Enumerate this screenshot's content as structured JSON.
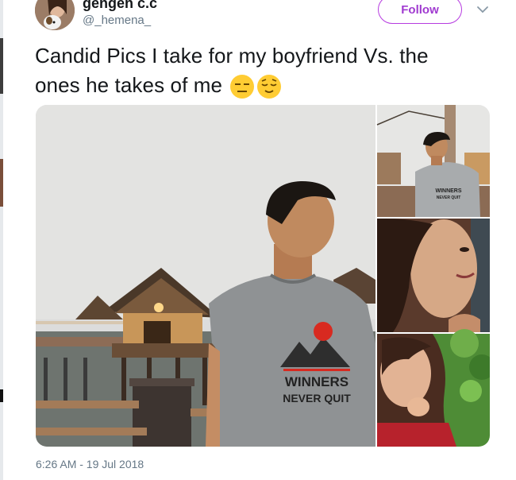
{
  "user": {
    "display_name": "gengen c.c",
    "handle": "@_hemena_",
    "avatar_icon": "avatar-with-dog"
  },
  "actions": {
    "follow_label": "Follow",
    "more_icon": "chevron-down-icon"
  },
  "tweet": {
    "text_line1": "Candid Pics I take for my boyfriend Vs. the",
    "text_line2": "ones he takes of me",
    "emojis": [
      "expressionless-face",
      "relieved-face"
    ],
    "timestamp": "6:26 AM - 19 Jul 2018"
  },
  "media": {
    "main_shirt_line1": "WINNERS",
    "main_shirt_line2": "NEVER QUIT",
    "thumb1_shirt_line1": "WINNERS",
    "thumb1_shirt_line2": "NEVER QUIT"
  },
  "colors": {
    "accent": "#b63be0",
    "text": "#14171a",
    "muted": "#657786"
  }
}
